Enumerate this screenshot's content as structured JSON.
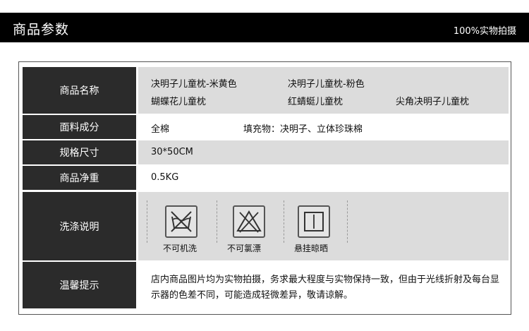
{
  "header": {
    "title": "商品参数",
    "note": "100%实物拍摄"
  },
  "rows": {
    "name": {
      "label": "商品名称",
      "values": [
        "决明子儿童枕-米黄色",
        "决明子儿童枕-粉色",
        "蝴蝶花儿童枕",
        "红蜻蜓儿童枕",
        "尖角决明子儿童枕"
      ]
    },
    "fabric": {
      "label": "面料成分",
      "value1": "全棉",
      "value2": "填充物：决明子、立体珍珠棉"
    },
    "size": {
      "label": "规格尺寸",
      "value": "30*50CM"
    },
    "weight": {
      "label": "商品净重",
      "value": "0.5KG"
    },
    "wash": {
      "label": "洗涤说明",
      "items": [
        {
          "icon": "no-machine-wash-icon",
          "label": "不可机洗"
        },
        {
          "icon": "no-bleach-icon",
          "label": "不可氯漂"
        },
        {
          "icon": "hang-dry-icon",
          "label": "悬挂晾晒"
        }
      ]
    },
    "tip": {
      "label": "温馨提示",
      "value": "店内商品图片均为实物拍摄，务求最大程度与实物保持一致，但由于光线折射及每台显示器的色差不同，可能造成轻微差异，敬请谅解。"
    }
  }
}
